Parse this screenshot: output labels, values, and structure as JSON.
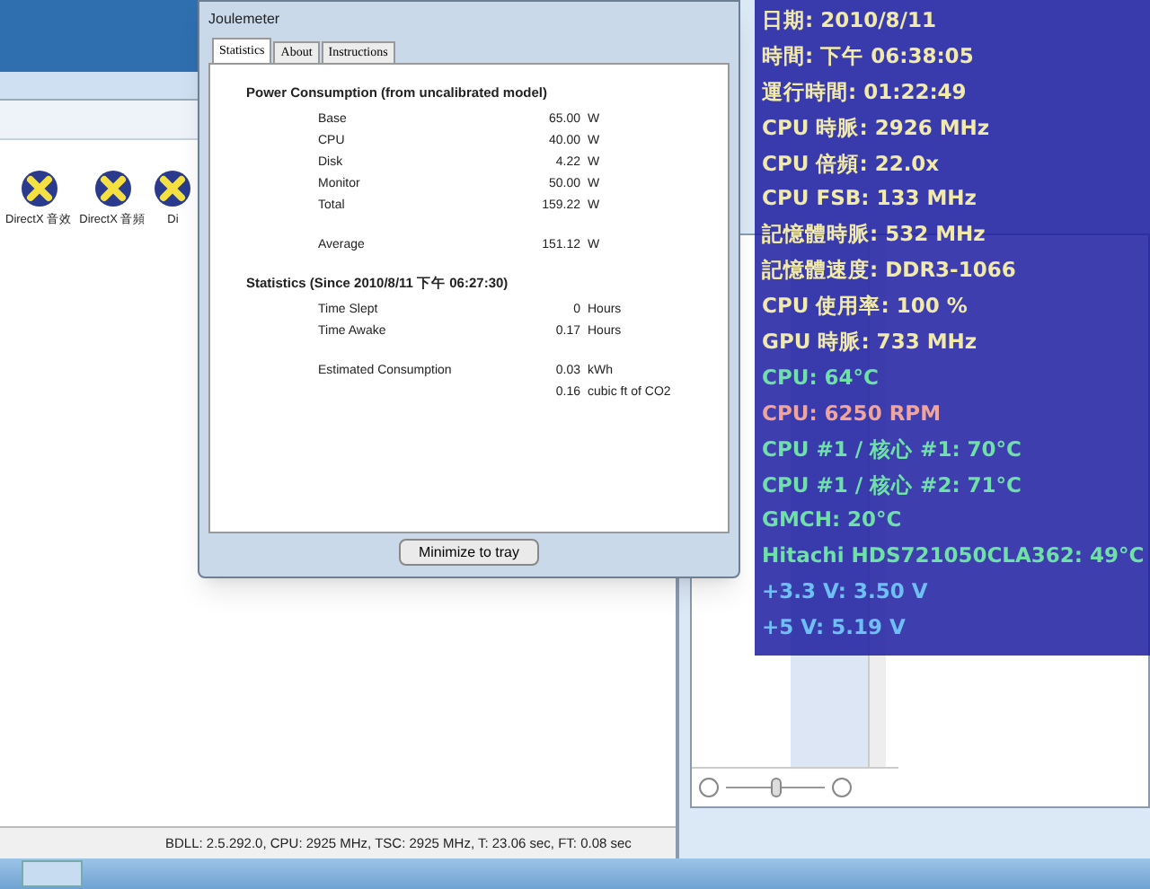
{
  "explorer": {
    "icons": [
      {
        "label": "DirectX 音效"
      },
      {
        "label": "DirectX 音頻"
      },
      {
        "label": "Di"
      }
    ],
    "status_bar": "BDLL: 2.5.292.0, CPU: 2925 MHz, TSC: 2925 MHz, T: 23.06 sec, FT: 0.08 sec"
  },
  "side_window": {
    "zoom_slider": {
      "level": 0.5
    }
  },
  "dialog": {
    "title": "Joulemeter",
    "tabs": [
      {
        "label": "Statistics",
        "selected": true
      },
      {
        "label": "About",
        "selected": false
      },
      {
        "label": "Instructions",
        "selected": false
      }
    ],
    "sections": [
      {
        "title": "Power Consumption (from uncalibrated model)",
        "groups": [
          [
            {
              "label": "Base",
              "value": "65.00",
              "unit": "W"
            },
            {
              "label": "CPU",
              "value": "40.00",
              "unit": "W"
            },
            {
              "label": "Disk",
              "value": "4.22",
              "unit": "W"
            },
            {
              "label": "Monitor",
              "value": "50.00",
              "unit": "W"
            },
            {
              "label": "Total",
              "value": "159.22",
              "unit": "W"
            }
          ],
          [
            {
              "label": "Average",
              "value": "151.12",
              "unit": "W"
            }
          ]
        ]
      },
      {
        "title": "Statistics (Since 2010/8/11 下午 06:27:30)",
        "groups": [
          [
            {
              "label": "Time Slept",
              "value": "0",
              "unit": "Hours"
            },
            {
              "label": "Time Awake",
              "value": "0.17",
              "unit": "Hours"
            }
          ],
          [
            {
              "label": "Estimated Consumption",
              "value": "0.03",
              "unit": "kWh"
            },
            {
              "value": "0.16",
              "unit": "cubic ft of CO2"
            }
          ]
        ]
      }
    ],
    "button": "Minimize to tray"
  },
  "monitor": {
    "lines": [
      {
        "text": "日期: 2010/8/11",
        "color": "#f2eaa8"
      },
      {
        "text": "時間: 下午 06:38:05",
        "color": "#f2eaa8"
      },
      {
        "text": "運行時間: 01:22:49",
        "color": "#f2eaa8"
      },
      {
        "text": "CPU 時脈: 2926 MHz",
        "color": "#f2eaa8"
      },
      {
        "text": "CPU 倍頻: 22.0x",
        "color": "#f2eaa8"
      },
      {
        "text": "CPU FSB: 133 MHz",
        "color": "#f2eaa8"
      },
      {
        "text": "記憶體時脈: 532 MHz",
        "color": "#f2eaa8"
      },
      {
        "text": "記憶體速度: DDR3-1066",
        "color": "#f2eaa8"
      },
      {
        "text": "CPU 使用率: 100 %",
        "color": "#f2eaa8"
      },
      {
        "text": "GPU 時脈: 733 MHz",
        "color": "#f2eaa8"
      },
      {
        "text": "CPU: 64°C",
        "color": "#6ee0a8"
      },
      {
        "text": "CPU: 6250 RPM",
        "color": "#f0a49a"
      },
      {
        "text": "CPU #1 / 核心 #1: 70°C",
        "color": "#6ee0a8"
      },
      {
        "text": "CPU #1 / 核心 #2: 71°C",
        "color": "#6ee0a8"
      },
      {
        "text": "GMCH: 20°C",
        "color": "#6ee0a8"
      },
      {
        "text": "Hitachi HDS721050CLA362: 49°C",
        "color": "#6ee0a8"
      },
      {
        "text": "+3.3 V: 3.50 V",
        "color": "#6ec0f4"
      },
      {
        "text": "+5 V: 5.19 V",
        "color": "#6ec0f4"
      }
    ]
  }
}
